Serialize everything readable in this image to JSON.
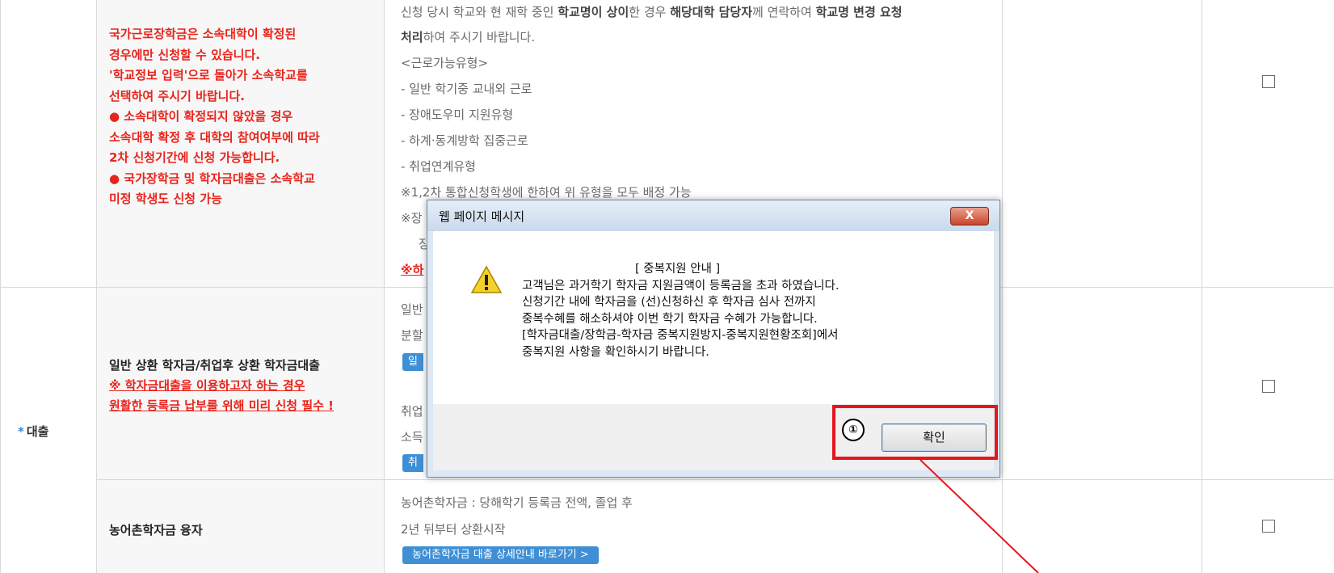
{
  "table": {
    "row1": {
      "red_note": [
        "국가근로장학금은 소속대학이 확정된",
        "경우에만 신청할 수 있습니다.",
        "'학교정보 입력'으로 돌아가 소속학교를",
        "선택하여 주시기 바랍니다.",
        "● 소속대학이 확정되지 않았을 경우",
        "소속대학 확정 후 대학의 참여여부에 따라",
        "2차 신청기간에 신청 가능합니다.",
        "● 국가장학금 및 학자금대출은 소속학교",
        "미정 학생도 신청 가능"
      ],
      "desc_line1_a": "신청 당시 학교와 현 재학 중인 ",
      "desc_line1_b": "학교명이 상이",
      "desc_line1_c": "한 경우 ",
      "desc_line1_d": "해당대학 담당자",
      "desc_line1_e": "께 연락하여 ",
      "desc_line1_f": "학교명 변경 요청",
      "desc_line2_a": "처리",
      "desc_line2_b": "하여 주시기 바랍니다.",
      "desc_types": [
        "<근로가능유형>",
        "- 일반 학기중 교내외 근로",
        "- 장애도우미 지원유형",
        "- 하계·동계방학 집중근로",
        "- 취업연계유형",
        "※1,2차 통합신청학생에 한하여 위 유형을 모두 배정 가능"
      ],
      "desc_partial1": "※장",
      "desc_partial2": "장",
      "desc_partial3": "※하"
    },
    "loan_category": "대출",
    "row2": {
      "title": "일반 상환 학자금/취업후 상환 학자금대출",
      "red_note1": "※ 학자금대출을 이용하고자 하는 경우",
      "red_note2": "원활한 등록금 납부를 위해 미리 신청 필수 !",
      "desc_partial1": "일반",
      "desc_partial2": "분할",
      "btn_partial1": "일",
      "desc_partial3": "취업",
      "desc_partial4": "소득",
      "btn_partial2": "취"
    },
    "row3": {
      "title": "농어촌학자금 융자",
      "desc1": "농어촌학자금 : 당해학기 등록금 전액, 졸업 후",
      "desc2": "2년 뒤부터 상환시작",
      "button": "농어촌학자금 대출 상세안내 바로가기 >"
    }
  },
  "dialog": {
    "title": "웹 페이지 메시지",
    "close_label": "X",
    "message": [
      "[ 중복지원 안내 ]",
      "고객님은 과거학기 학자금 지원금액이 등록금을 초과 하였습니다.",
      "신청기간 내에 학자금을 (선)신청하신 후 학자금 심사 전까지",
      "중복수혜를 해소하셔야 이번 학기 학자금 수혜가 가능합니다.",
      "[학자금대출/장학금-학자금 중복지원방지-중복지원현황조회]에서",
      "중복지원 사항을 확인하시기 바랍니다."
    ],
    "ok_label": "확인"
  },
  "annotation": {
    "step_number": "①",
    "highlight_color": "#e8141c"
  },
  "colors": {
    "accent_red": "#e8241c",
    "button_blue": "#3f8fd6",
    "dialog_frame": "#dde8f4"
  }
}
